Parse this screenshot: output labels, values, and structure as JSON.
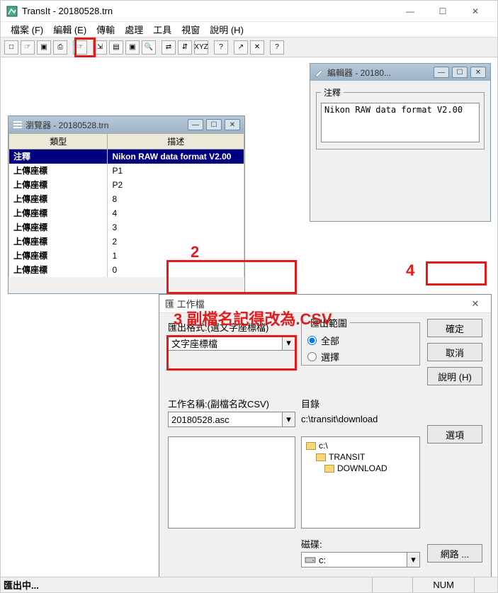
{
  "window": {
    "title": "TransIt - 20180528.trn",
    "min": "—",
    "max": "☐",
    "close": "✕"
  },
  "menu": {
    "file": "檔案 (F)",
    "edit": "編輯 (E)",
    "transfer": "傳輸",
    "process": "處理",
    "tools": "工具",
    "view": "視窗",
    "help": "說明 (H)"
  },
  "toolbar_icons": [
    "□",
    "☞",
    "▣",
    "⎙",
    "·",
    "☞",
    "·",
    "⇲",
    "▤",
    "▣",
    "🔍",
    "·",
    "⇄",
    "⇵",
    "XYZ",
    "·",
    "?",
    "·",
    "↗",
    "✕",
    "·",
    "?"
  ],
  "browser": {
    "title": "瀏覽器 - 20180528.trn",
    "col_type": "類型",
    "col_desc": "描述",
    "rows": [
      {
        "type": "注釋",
        "desc": "Nikon RAW data format V2.00",
        "selected": true
      },
      {
        "type": "上傳座標",
        "desc": "P1"
      },
      {
        "type": "上傳座標",
        "desc": "P2"
      },
      {
        "type": "上傳座標",
        "desc": "8"
      },
      {
        "type": "上傳座標",
        "desc": "4"
      },
      {
        "type": "上傳座標",
        "desc": "3"
      },
      {
        "type": "上傳座標",
        "desc": "2"
      },
      {
        "type": "上傳座標",
        "desc": "1"
      },
      {
        "type": "上傳座標",
        "desc": "0"
      }
    ]
  },
  "editor": {
    "title": "編輯器 - 20180...",
    "legend": "注釋",
    "value": "Nikon RAW data format V2.00"
  },
  "dialog": {
    "title": "匯    工作檔",
    "format_label": "匯出格式:(選文字座標檔)",
    "format_value": "文字座標檔",
    "range_legend": "匯出範圍",
    "range_all": "全部",
    "range_sel": "選擇",
    "name_label": "工作名稱:(副檔名改CSV)",
    "name_value": "20180528.asc",
    "dir_label": "目錄",
    "dir_value": "c:\\transit\\download",
    "tree": [
      "c:\\",
      "TRANSIT",
      "DOWNLOAD"
    ],
    "disk_label": "磁碟:",
    "disk_value": "c:",
    "btn_ok": "確定",
    "btn_cancel": "取消",
    "btn_help": "說明 (H)",
    "btn_options": "選項",
    "btn_network": "網路 ..."
  },
  "annotations": {
    "n2": "2",
    "n3": "3 副檔名記得改為.CSV",
    "n4": "4"
  },
  "statusbar": {
    "left": "匯出中...",
    "num": "NUM"
  }
}
